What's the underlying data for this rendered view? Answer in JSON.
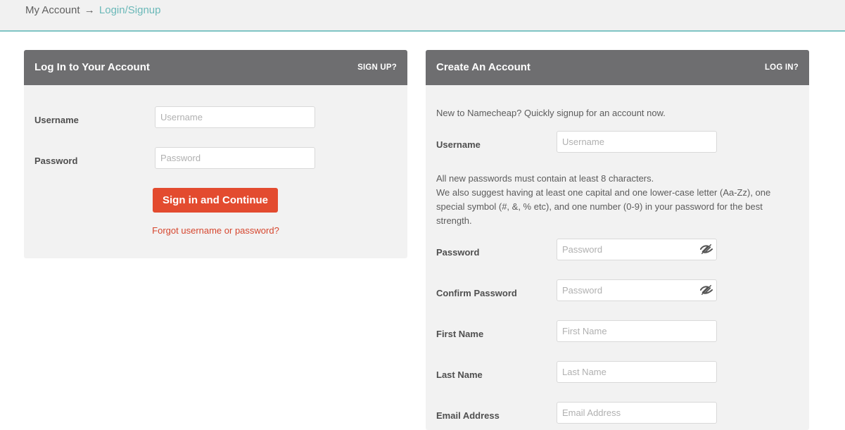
{
  "breadcrumb": {
    "root": "My Account",
    "separator": "→",
    "current": "Login/Signup"
  },
  "login": {
    "title": "Log In to Your Account",
    "switch_link": "SIGN UP?",
    "username_label": "Username",
    "username_placeholder": "Username",
    "password_label": "Password",
    "password_placeholder": "Password",
    "submit_label": "Sign in and Continue",
    "forgot_link": "Forgot username or password?"
  },
  "signup": {
    "title": "Create An Account",
    "switch_link": "LOG IN?",
    "intro": "New to Namecheap? Quickly signup for an account now.",
    "username_label": "Username",
    "username_placeholder": "Username",
    "password_rules_1": "All new passwords must contain at least 8 characters.",
    "password_rules_2": "We also suggest having at least one capital and one lower-case letter (Aa-Zz), one special symbol (#, &, % etc), and one number (0-9) in your password for the best strength.",
    "password_label": "Password",
    "password_placeholder": "Password",
    "confirm_label": "Confirm Password",
    "confirm_placeholder": "Password",
    "first_name_label": "First Name",
    "first_name_placeholder": "First Name",
    "last_name_label": "Last Name",
    "last_name_placeholder": "Last Name",
    "email_label": "Email Address",
    "email_placeholder": "Email Address"
  },
  "icons": {
    "password_toggle": "eye-slash-icon"
  },
  "colors": {
    "accent": "#6ab8b8",
    "primary_button": "#e34b2f",
    "link": "#d6462e",
    "panel_header": "#6e6e70"
  }
}
